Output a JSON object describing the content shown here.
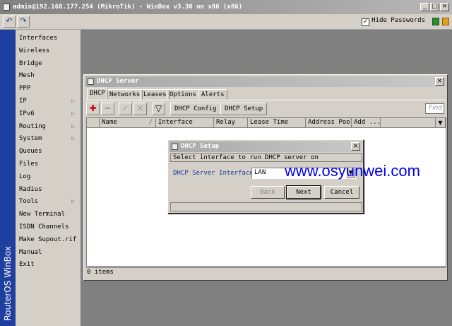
{
  "window": {
    "title": "admin@192.168.177.254 (MikroTik) - WinBox v3.30 on x86 (x86)",
    "min": "_",
    "max": "□",
    "close": "×"
  },
  "toolbar": {
    "undo": "↶",
    "redo": "↷",
    "hide_passwords_label": "Hide Passwords",
    "hide_passwords_checked": "✓"
  },
  "brand": "RouterOS WinBox",
  "menu": [
    {
      "label": "Interfaces",
      "arrow": ""
    },
    {
      "label": "Wireless",
      "arrow": ""
    },
    {
      "label": "Bridge",
      "arrow": ""
    },
    {
      "label": "Mesh",
      "arrow": ""
    },
    {
      "label": "PPP",
      "arrow": ""
    },
    {
      "label": "IP",
      "arrow": "▷"
    },
    {
      "label": "IPv6",
      "arrow": "▷"
    },
    {
      "label": "Routing",
      "arrow": "▷"
    },
    {
      "label": "System",
      "arrow": "▷"
    },
    {
      "label": "Queues",
      "arrow": ""
    },
    {
      "label": "Files",
      "arrow": ""
    },
    {
      "label": "Log",
      "arrow": ""
    },
    {
      "label": "Radius",
      "arrow": ""
    },
    {
      "label": "Tools",
      "arrow": "▷"
    },
    {
      "label": "New Terminal",
      "arrow": ""
    },
    {
      "label": "ISDN Channels",
      "arrow": ""
    },
    {
      "label": "Make Supout.rif",
      "arrow": ""
    },
    {
      "label": "Manual",
      "arrow": ""
    },
    {
      "label": "Exit",
      "arrow": ""
    }
  ],
  "dhcp_window": {
    "title": "DHCP Server",
    "close": "×",
    "tabs": [
      "DHCP",
      "Networks",
      "Leases",
      "Options",
      "Alerts"
    ],
    "tools": {
      "add": "✚",
      "remove": "━",
      "enable": "✓",
      "disable": "✕",
      "filter": "▽"
    },
    "buttons": {
      "dhcp_config": "DHCP Config",
      "dhcp_setup": "DHCP Setup"
    },
    "find": "Find",
    "columns": [
      "",
      "Name",
      "Interface",
      "Relay",
      "Lease Time",
      "Address Pool",
      "Add ..."
    ],
    "sort_indicator": "/",
    "col_menu": "▼",
    "status": "0 items"
  },
  "setup_dialog": {
    "title": "DHCP Setup",
    "close": "×",
    "message": "Select interface to run DHCP server on",
    "field_label": "DHCP Server Interface:",
    "field_value": "LAN",
    "dropdown": "▼",
    "back": "Back",
    "next": "Next",
    "cancel": "Cancel"
  },
  "watermark": "www.osyunwei.com"
}
